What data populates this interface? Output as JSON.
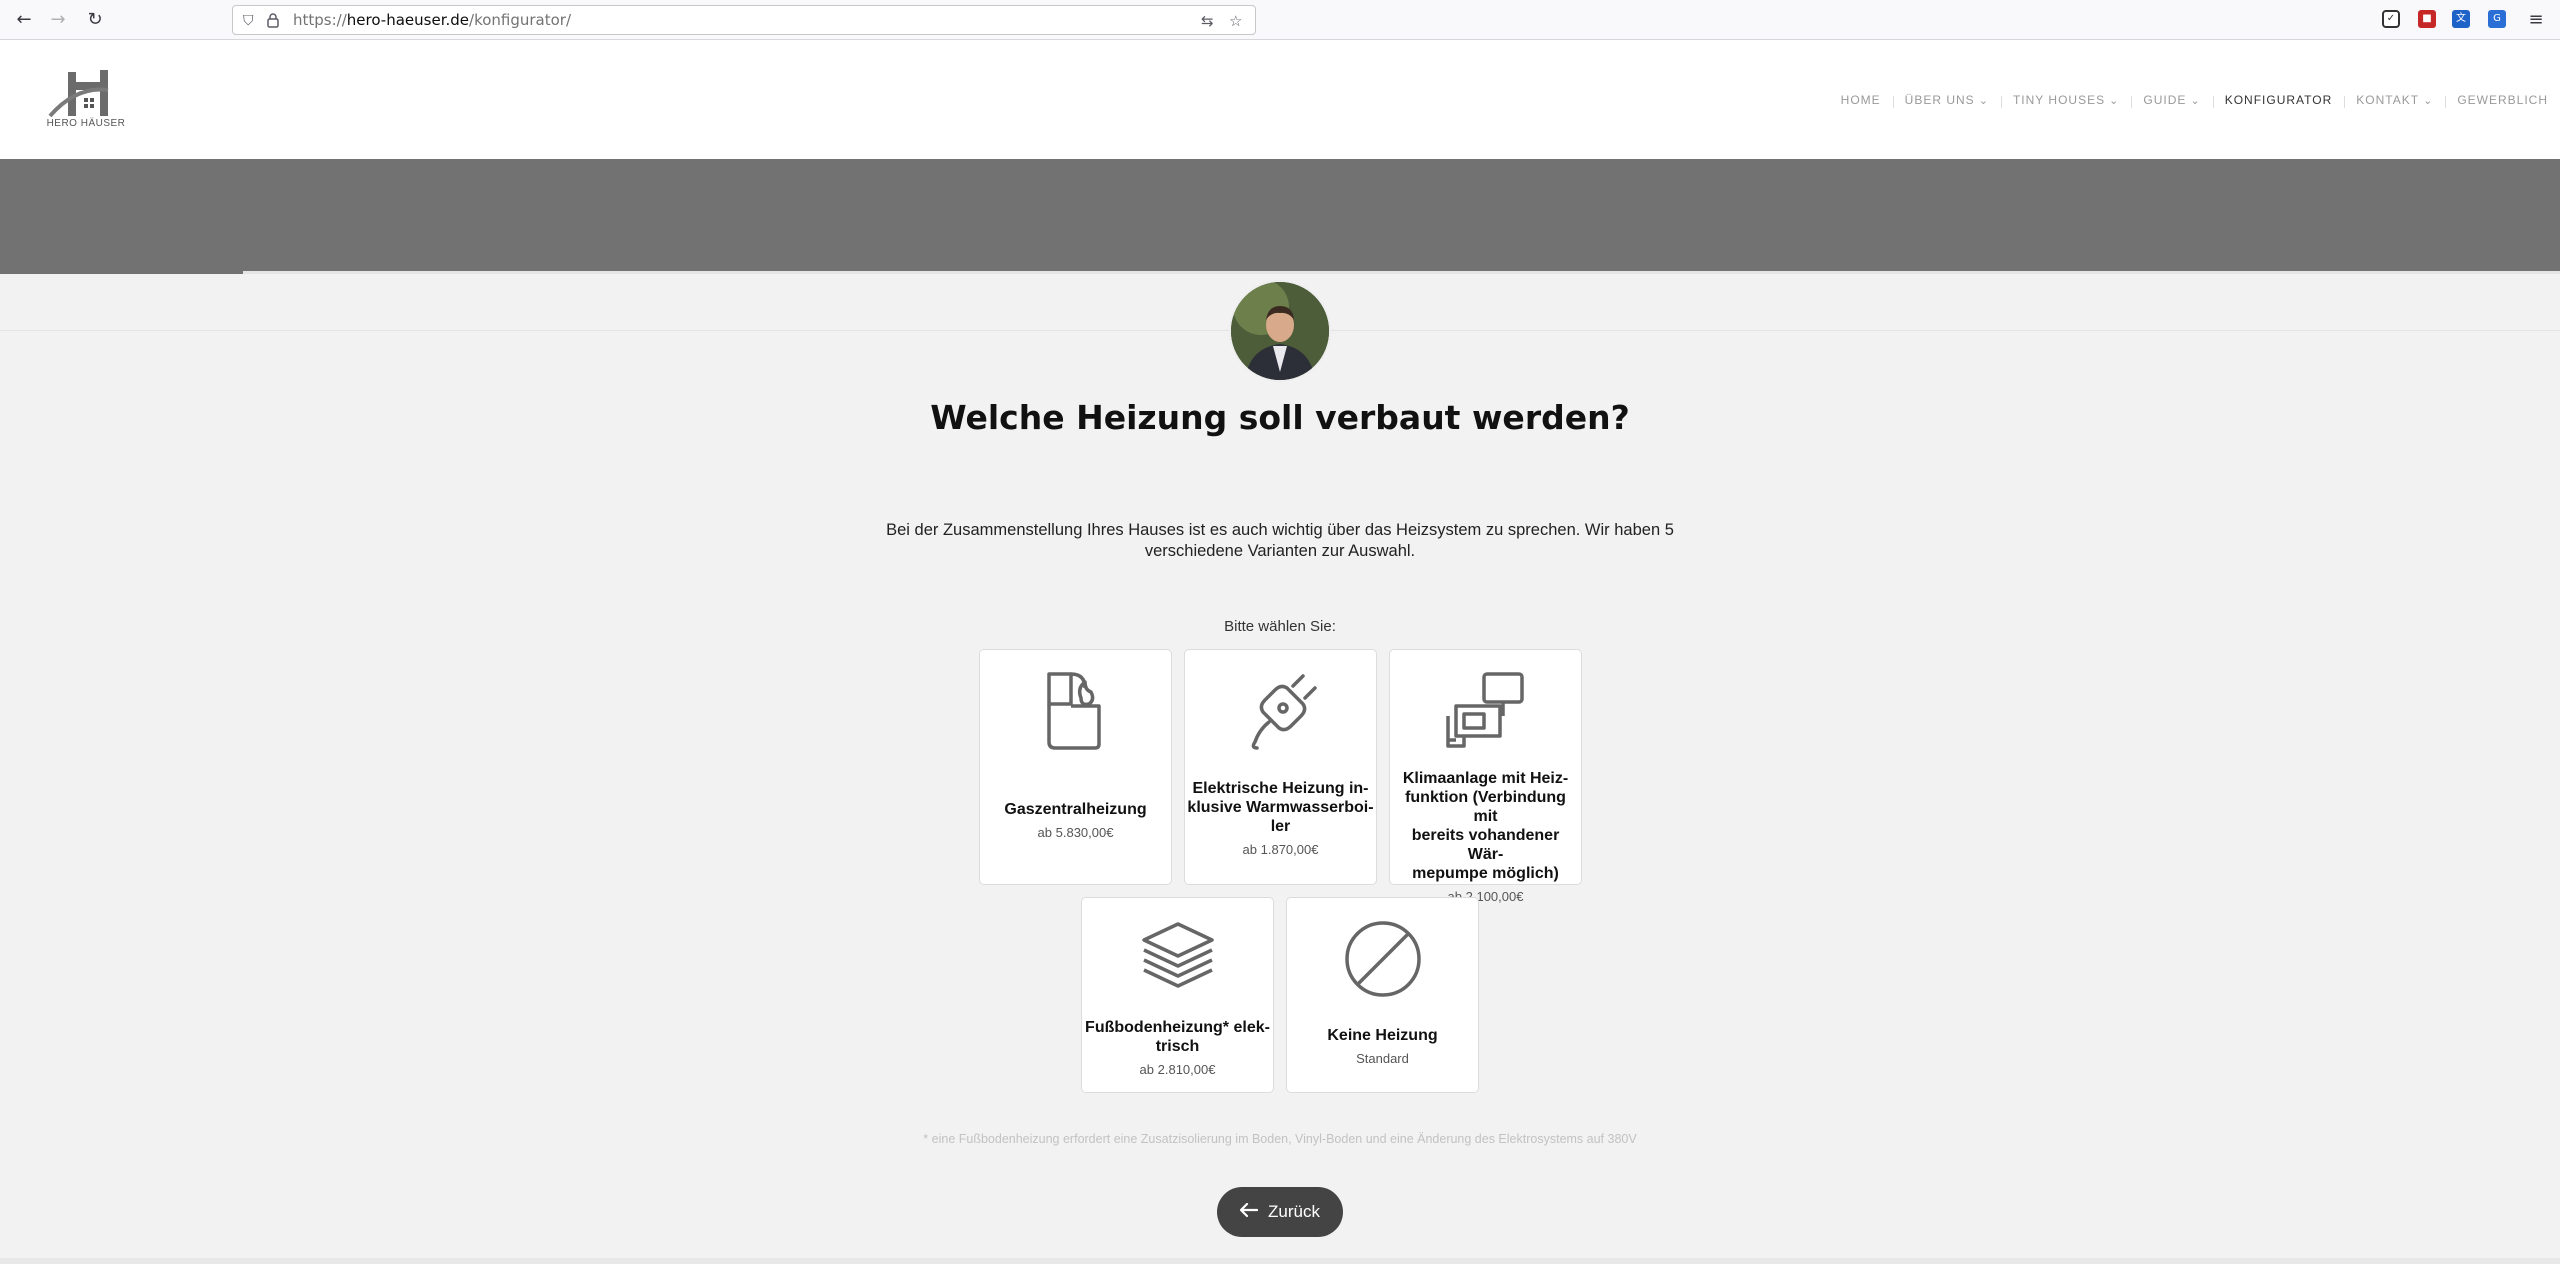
{
  "browser": {
    "url_prefix": "https://",
    "url_host": "hero-haeuser.de",
    "url_path": "/konfigurator/"
  },
  "site": {
    "logo_text": "HERO HÄUSER",
    "nav": [
      {
        "label": "HOME",
        "dropdown": false,
        "active": false
      },
      {
        "label": "ÜBER UNS",
        "dropdown": true,
        "active": false
      },
      {
        "label": "TINY HOUSES",
        "dropdown": true,
        "active": false
      },
      {
        "label": "GUIDE",
        "dropdown": true,
        "active": false
      },
      {
        "label": "KONFIGURATOR",
        "dropdown": false,
        "active": true
      },
      {
        "label": "KONTAKT",
        "dropdown": true,
        "active": false
      },
      {
        "label": "GEWERBLICH",
        "dropdown": false,
        "active": false
      }
    ]
  },
  "progress": {
    "fraction": 0.095
  },
  "question": {
    "title": "Welche Heizung soll verbaut werden?",
    "intro": "Bei der Zusammenstellung Ihres Hauses ist es auch wichtig über das Heizsystem zu sprechen. Wir haben 5 verschiedene Varianten zur Auswahl.",
    "choose_label": "Bitte wählen Sie:"
  },
  "options": [
    {
      "icon": "lighter-icon",
      "label": "Gaszentralheizung",
      "price": "ab 5.830,00€"
    },
    {
      "icon": "plug-icon",
      "label": "Elektrische Heizung in-klusive Warmwasserboi-ler",
      "label_lines": [
        "Elektrische Heizung in-",
        "klusive Warmwasserboi-",
        "ler"
      ],
      "price": "ab 1.870,00€"
    },
    {
      "icon": "air-conditioner-icon",
      "label": "Klimaanlage mit Heiz-funktion (Verbindung mit bereits vohandener Wär-mepumpe möglich)",
      "label_lines": [
        "Klimaanlage mit Heiz-",
        "funktion (Verbindung mit",
        "bereits vohandener Wär-",
        "mepumpe möglich)"
      ],
      "price": "ab 2.100,00€"
    },
    {
      "icon": "layers-icon",
      "label": "Fußbodenheizung* elek-trisch",
      "label_lines": [
        "Fußbodenheizung* elek-",
        "trisch"
      ],
      "price": "ab 2.810,00€"
    },
    {
      "icon": "none-icon",
      "label": "Keine Heizung",
      "price": "Standard"
    }
  ],
  "footnote": "* eine Fußbodenheizung erfordert eine Zusatzisolierung im Boden, Vinyl-Boden und eine Änderung des Elektrosystems auf 380V",
  "back_button": {
    "label": "Zurück"
  }
}
